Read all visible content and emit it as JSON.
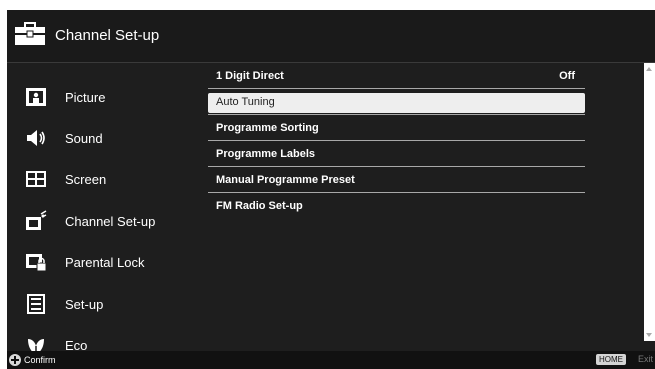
{
  "header": {
    "title": "Channel Set-up",
    "icon": "toolbox-icon"
  },
  "sidebar": {
    "items": [
      {
        "label": "Picture",
        "icon": "picture-icon"
      },
      {
        "label": "Sound",
        "icon": "speaker-icon"
      },
      {
        "label": "Screen",
        "icon": "screen-icon"
      },
      {
        "label": "Channel Set-up",
        "icon": "channel-setup-icon"
      },
      {
        "label": "Parental Lock",
        "icon": "parental-lock-icon"
      },
      {
        "label": "Set-up",
        "icon": "setup-icon"
      },
      {
        "label": "Eco",
        "icon": "eco-icon"
      }
    ]
  },
  "menu": {
    "items": [
      {
        "label": "1 Digit Direct",
        "value": "Off"
      },
      {
        "label": "Auto Tuning",
        "value": "",
        "selected": true
      },
      {
        "label": "Programme Sorting",
        "value": ""
      },
      {
        "label": "Programme Labels",
        "value": ""
      },
      {
        "label": "Manual Programme Preset",
        "value": ""
      },
      {
        "label": "FM Radio Set-up",
        "value": ""
      }
    ]
  },
  "footer": {
    "confirm_label": "Confirm",
    "home_label": "HOME",
    "exit_label": "Exit"
  },
  "colors": {
    "background": "#1e1e1e",
    "header": "#1a1a1a",
    "selected_row": "#eeeeee",
    "text": "#ffffff"
  }
}
